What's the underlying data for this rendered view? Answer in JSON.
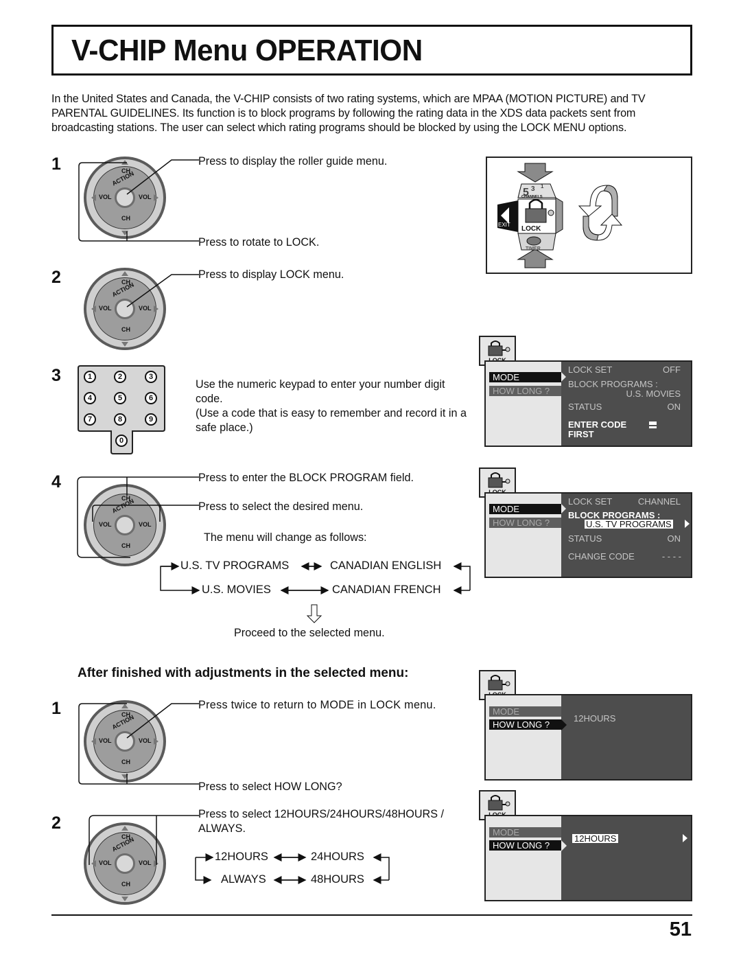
{
  "page": {
    "title": "V-CHIP Menu OPERATION",
    "intro": "In the United States and Canada, the V-CHIP consists of two rating systems, which are MPAA (MOTION PICTURE) and TV PARENTAL GUIDELINES. Its function is to block programs by following the rating data in the XDS data packets sent from broadcasting stations. The user can select which rating programs should be blocked by using the LOCK MENU options.",
    "page_number": "51"
  },
  "dial_labels": {
    "ch": "CH",
    "vol": "VOL",
    "action": "ACTION"
  },
  "steps": [
    {
      "num": "1",
      "callouts": [
        "Press to display the roller guide menu.",
        "Press to rotate to LOCK."
      ]
    },
    {
      "num": "2",
      "callouts": [
        "Press to display LOCK menu."
      ]
    },
    {
      "num": "3",
      "text": [
        "Use the numeric keypad to enter your number digit code.",
        "(Use a code that is easy to remember and record it in a safe place.)"
      ],
      "keypad": [
        "1",
        "2",
        "3",
        "4",
        "5",
        "6",
        "7",
        "8",
        "9",
        "0"
      ]
    },
    {
      "num": "4",
      "callouts": [
        "Press to enter the BLOCK PROGRAM field.",
        "Press to select the desired menu."
      ],
      "cycle_intro": "The menu will change as follows:",
      "cycle": [
        "U.S. TV PROGRAMS",
        "CANADIAN ENGLISH",
        "U.S. MOVIES",
        "CANADIAN FRENCH"
      ],
      "proceed": "Proceed to the selected menu."
    }
  ],
  "after": {
    "heading": "After finished with adjustments in the selected menu:",
    "steps": [
      {
        "num": "1",
        "callouts": [
          "Press twice to return to MODE in LOCK menu.",
          "Press to select HOW LONG?"
        ]
      },
      {
        "num": "2",
        "callouts": [
          "Press to select 12HOURS/24HOURS/48HOURS / ALWAYS."
        ],
        "cycle": [
          "12HOURS",
          "24HOURS",
          "ALWAYS",
          "48HOURS"
        ]
      }
    ]
  },
  "roller": {
    "channels": "CHANNELS",
    "exit": "EXIT",
    "lock": "LOCK",
    "timer": "TIMER",
    "digits": "5 3 1"
  },
  "menus": {
    "lock_label": "LOCK",
    "mode": "MODE",
    "how_long": "HOW LONG ?",
    "menu1": {
      "lock_set": "LOCK  SET",
      "lock_set_val": "OFF",
      "block": "BLOCK  PROGRAMS :",
      "block_val": "U.S. MOVIES",
      "status": "STATUS",
      "status_val": "ON",
      "enter_code": "ENTER  CODE",
      "first": "FIRST"
    },
    "menu2": {
      "lock_set": "LOCK  SET",
      "lock_set_val": "CHANNEL",
      "block": "BLOCK  PROGRAMS :",
      "block_val": "U.S. TV  PROGRAMS",
      "status": "STATUS",
      "status_val": "ON",
      "change_code": "CHANGE  CODE",
      "change_code_val": "- - - -"
    },
    "menu3": {
      "value": "12HOURS"
    },
    "menu4": {
      "value": "12HOURS"
    }
  },
  "colors": {
    "menu_dark": "#4d4d4d",
    "menu_light": "#e6e6e6",
    "dial_outer": "#cfcfcf",
    "dial_inner": "#9d9d9d"
  }
}
